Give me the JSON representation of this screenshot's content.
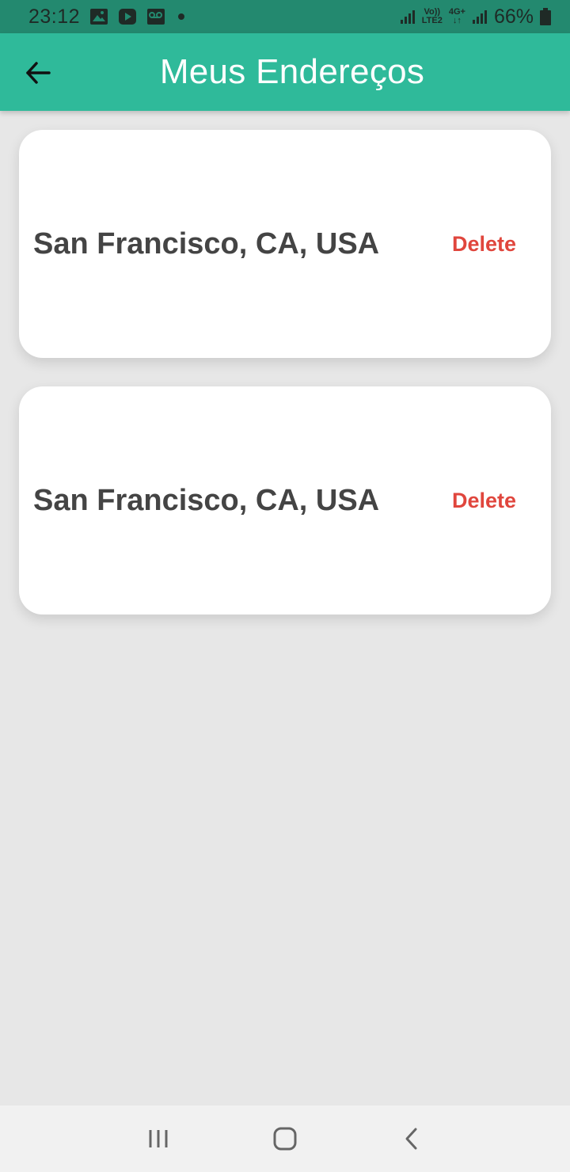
{
  "status_bar": {
    "time": "23:12",
    "network_top": "Vo))",
    "network_bottom": "LTE2",
    "network_type": "4G+",
    "battery": "66%",
    "icons": [
      "image-icon",
      "video-app-icon",
      "voicemail-icon",
      "notification-dot",
      "signal-icon",
      "battery-icon"
    ]
  },
  "app_bar": {
    "title": "Meus Endereços",
    "back_icon": "arrow-left-icon",
    "color": "#2fba9a"
  },
  "addresses": [
    {
      "text": "San Francisco, CA, USA",
      "action": "Delete"
    },
    {
      "text": "San Francisco, CA, USA",
      "action": "Delete"
    }
  ],
  "nav_bar": {
    "buttons": [
      "recent-apps-icon",
      "home-icon",
      "back-icon"
    ]
  },
  "colors": {
    "accent": "#2fba9a",
    "status_bar": "#23896f",
    "delete": "#e0463d",
    "background": "#e7e7e7"
  }
}
